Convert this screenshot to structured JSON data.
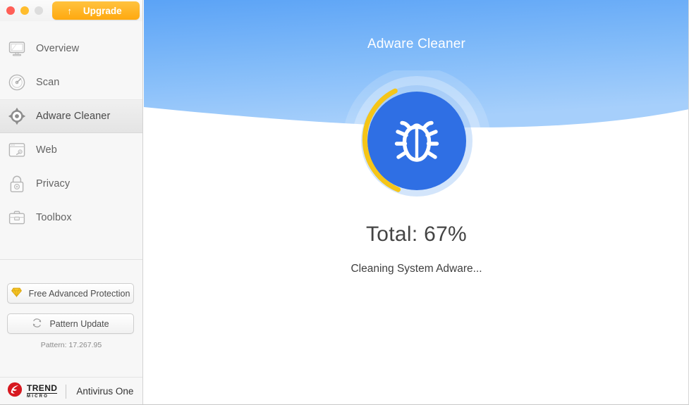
{
  "window": {
    "traffic_lights": [
      {
        "name": "close",
        "color": "#ff5f57"
      },
      {
        "name": "minimize",
        "color": "#ffbd2e"
      },
      {
        "name": "zoom",
        "color": "#dddddd"
      }
    ]
  },
  "sidebar": {
    "upgrade": {
      "label": "Upgrade",
      "icon": "up-arrow-icon",
      "glyph": "↑"
    },
    "items": [
      {
        "label": "Overview",
        "icon": "monitor-icon",
        "active": false
      },
      {
        "label": "Scan",
        "icon": "radar-icon",
        "active": false
      },
      {
        "label": "Adware Cleaner",
        "icon": "crosshair-icon",
        "active": true
      },
      {
        "label": "Web",
        "icon": "browser-icon",
        "active": false
      },
      {
        "label": "Privacy",
        "icon": "lock-icon",
        "active": false
      },
      {
        "label": "Toolbox",
        "icon": "briefcase-icon",
        "active": false
      }
    ],
    "free_protection_button": {
      "label": "Free Advanced Protection",
      "icon": "diamond-icon"
    },
    "pattern_update_button": {
      "label": "Pattern Update",
      "icon": "refresh-icon"
    },
    "pattern_version": "Pattern: 17.267.95",
    "brand": {
      "logo": "trend-micro-logo",
      "logo_top": "TREND",
      "logo_bottom": "MICRO",
      "product": "Antivirus One"
    }
  },
  "main": {
    "title": "Adware Cleaner",
    "gauge": {
      "icon": "bug-icon",
      "percent": 67,
      "arc_color": "#f5c518",
      "disc_color": "#2f6fe4"
    },
    "total_label": "Total: 67%",
    "status_text": "Cleaning System Adware..."
  },
  "colors": {
    "accent_blue": "#2f6fe4",
    "hero_blue_top": "#63a6f5",
    "hero_blue_bottom": "#9fcaf9",
    "upgrade_orange": "#ffa90f",
    "brand_red": "#d71920",
    "arc_yellow": "#f5c518"
  }
}
